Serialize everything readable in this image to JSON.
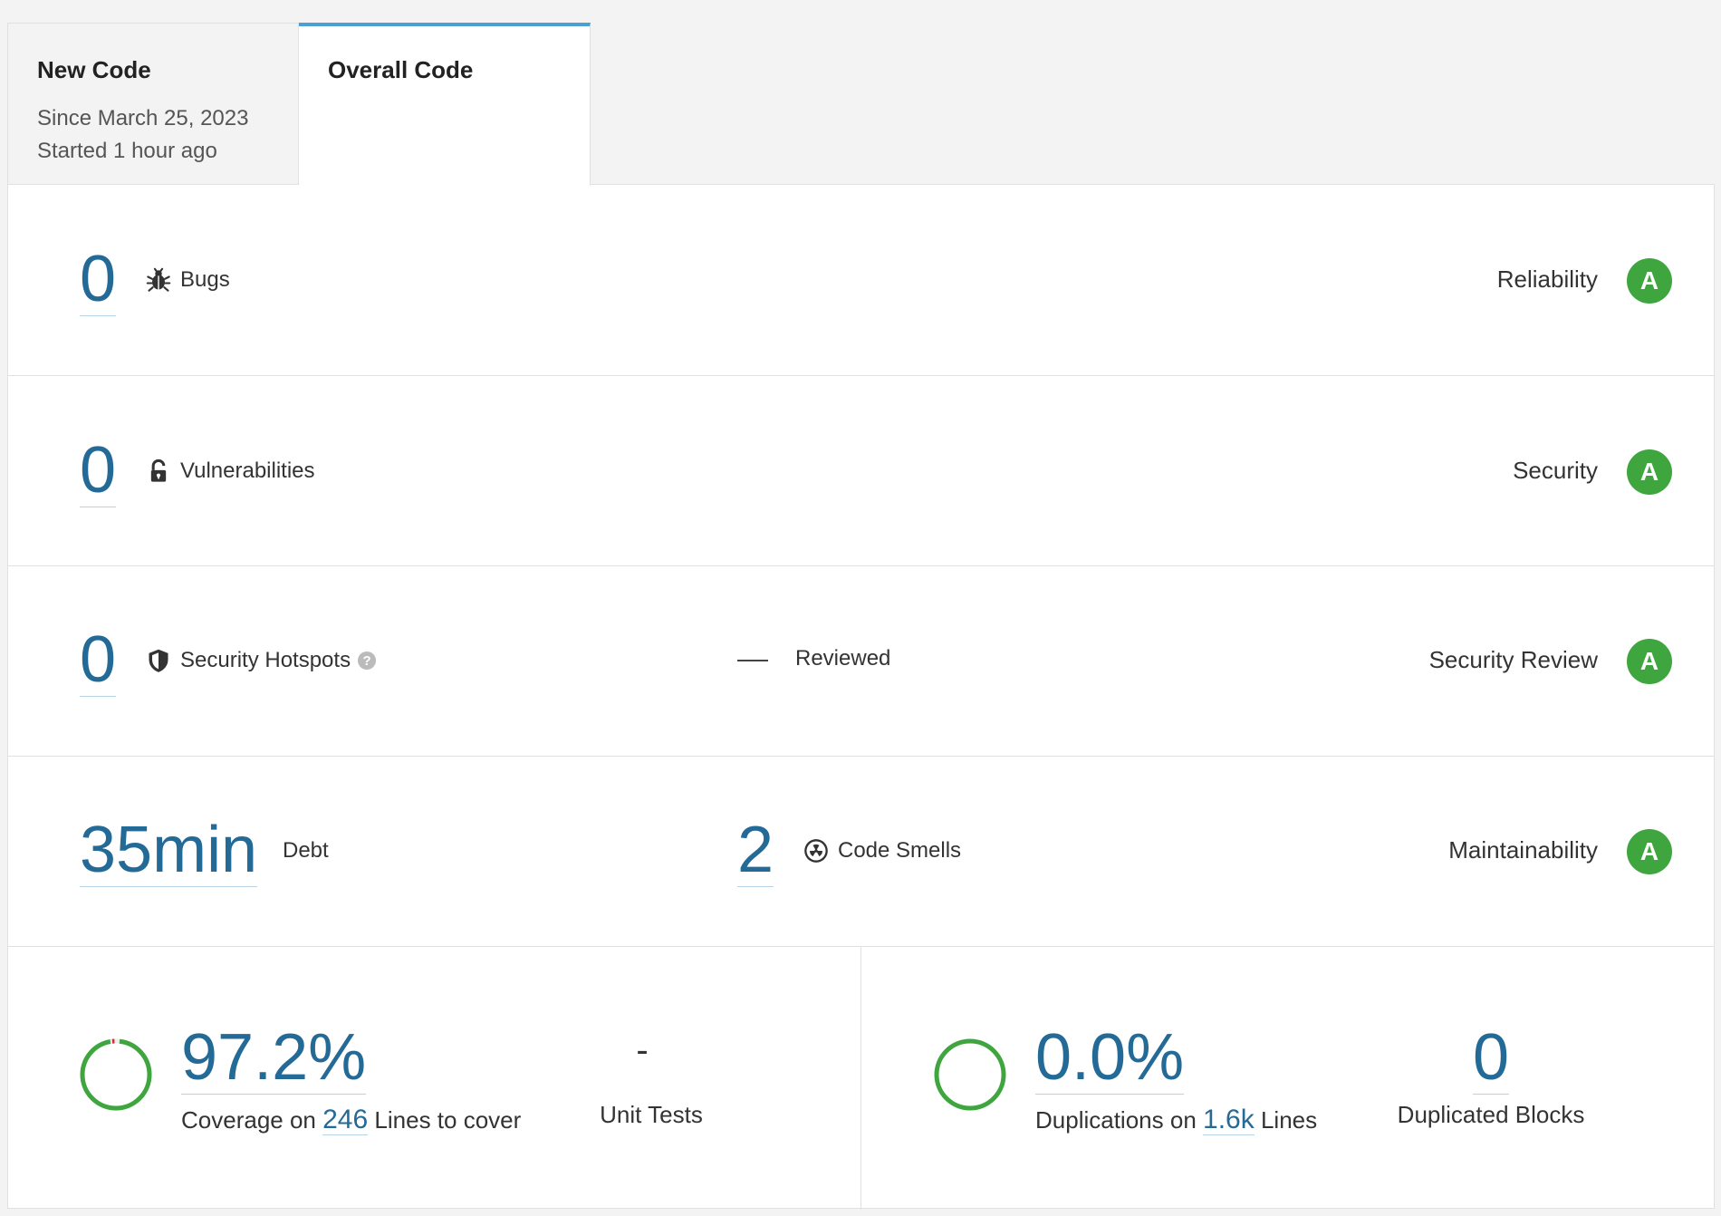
{
  "tabs": [
    {
      "title": "New Code",
      "line1": "Since March 25, 2023",
      "line2": "Started 1 hour ago"
    },
    {
      "title": "Overall Code"
    }
  ],
  "reliability": {
    "value": "0",
    "label": "Bugs",
    "rating_label": "Reliability",
    "grade": "A",
    "icon": "bug-icon"
  },
  "security": {
    "value": "0",
    "label": "Vulnerabilities",
    "rating_label": "Security",
    "grade": "A",
    "icon": "lock-icon"
  },
  "hotspots": {
    "value": "0",
    "label": "Security Hotspots",
    "help": "?",
    "reviewed_value": "—",
    "reviewed_label": "Reviewed",
    "rating_label": "Security Review",
    "grade": "A",
    "icon": "shield-icon"
  },
  "maintainability": {
    "debt_value": "35min",
    "debt_label": "Debt",
    "smells_value": "2",
    "smells_label": "Code Smells",
    "rating_label": "Maintainability",
    "grade": "A",
    "icon": "radiation-icon"
  },
  "coverage": {
    "value": "97.2%",
    "fraction": 0.972,
    "prefix": "Coverage on",
    "lines": "246",
    "suffix": "Lines to cover",
    "tests_value": "-",
    "tests_label": "Unit Tests"
  },
  "duplications": {
    "value": "0.0%",
    "fraction": 0.0,
    "prefix": "Duplications on",
    "lines": "1.6k",
    "suffix": "Lines",
    "blocks_value": "0",
    "blocks_label": "Duplicated Blocks"
  },
  "colors": {
    "accent": "#236a97",
    "grade_a": "#3fa63f",
    "tab_active": "#4b9fd5",
    "uncovered": "#d02f3a"
  }
}
